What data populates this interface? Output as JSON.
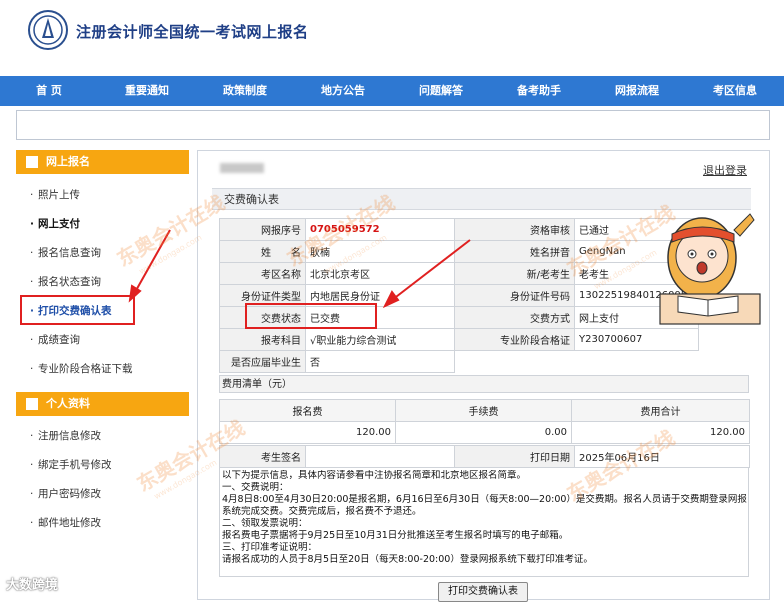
{
  "site": {
    "title": "注册会计师全国统一考试网上报名"
  },
  "nav": [
    "首 页",
    "重要通知",
    "政策制度",
    "地方公告",
    "问题解答",
    "备考助手",
    "网报流程",
    "考区信息"
  ],
  "sidebar": {
    "section1": "网上报名",
    "items1": [
      "照片上传",
      "网上支付",
      "报名信息查询",
      "报名状态查询",
      "打印交费确认表",
      "成绩查询",
      "专业阶段合格证下载"
    ],
    "section2": "个人资料",
    "items2": [
      "注册信息修改",
      "绑定手机号修改",
      "用户密码修改",
      "邮件地址修改"
    ]
  },
  "main": {
    "logout": "退出登录",
    "panel_title": "交费确认表",
    "rows": {
      "r1": {
        "l1": "网报序号",
        "v1": "0705059572",
        "l2": "资格审核",
        "v2": "已通过"
      },
      "r2": {
        "l1": "姓　　名",
        "v1": "耿楠",
        "l2": "姓名拼音",
        "v2": "GengNan"
      },
      "r3": {
        "l1": "考区名称",
        "v1": "北京北京考区",
        "l2": "新/老考生",
        "v2": "老考生"
      },
      "r4": {
        "l1": "身份证件类型",
        "v1": "内地居民身份证",
        "l2": "身份证件号码",
        "v2": "130225198401260051"
      },
      "r5": {
        "l1": "交费状态",
        "v1": "已交费",
        "l2": "交费方式",
        "v2": "网上支付"
      },
      "r6": {
        "l1": "报考科目",
        "v1": "√职业能力综合测试",
        "l2": "专业阶段合格证",
        "v2": "Y230700607"
      },
      "r7": {
        "l1": "是否应届毕业生",
        "v1": "否"
      }
    },
    "fee": {
      "title": "费用清单（元）",
      "headers": [
        "报名费",
        "手续费",
        "费用合计"
      ],
      "values": [
        "120.00",
        "0.00",
        "120.00"
      ]
    },
    "sign": {
      "label": "考生签名",
      "date_label": "打印日期",
      "date": "2025年06月16日"
    },
    "notes": [
      "以下为提示信息，具体内容请参看中注协报名简章和北京地区报名简章。",
      "一、交费说明：",
      "4月8日8:00至4月30日20:00是报名期，6月16日至6月30日（每天8:00—20:00）是交费期。报名人员请于交费期登录网报",
      "系统完成交费。交费完成后，报名费不予退还。",
      "二、领取发票说明：",
      "报名费电子票据将于9月25日至10月31日分批推送至考生报名时填写的电子邮箱。",
      "三、打印准考证说明：",
      "请报名成功的人员于8月5日至20日（每天8:00-20:00）登录网报系统下载打印准考证。"
    ],
    "print_button": "打印交费确认表"
  },
  "watermark": {
    "text": "东奥会计在线",
    "url": "www.dongao.com"
  },
  "bottom_logo": "大数跨境"
}
